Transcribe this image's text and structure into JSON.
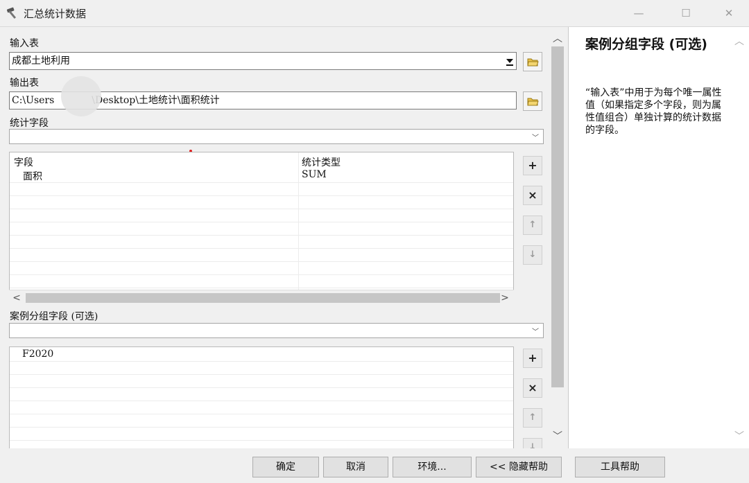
{
  "window": {
    "title": "汇总统计数据",
    "icon": "hammer-icon",
    "minimize_glyph": "—",
    "maximize_glyph": "☐",
    "close_glyph": "✕"
  },
  "form": {
    "input_table": {
      "label": "输入表",
      "value": "成都土地利用"
    },
    "output_table": {
      "label": "输出表",
      "value_before": "C:\\Users",
      "value_after": "\\Desktop\\土地统计\\面积统计"
    },
    "stats_field": {
      "label": "统计字段",
      "value": ""
    },
    "stats_grid": {
      "headers": [
        "字段",
        "统计类型"
      ],
      "rows": [
        {
          "field": "面积",
          "type": "SUM"
        }
      ]
    },
    "case_field": {
      "label": "案例分组字段 (可选)",
      "value": ""
    },
    "case_list": {
      "items": [
        "F2020"
      ]
    },
    "side_buttons": {
      "add": "+",
      "remove": "×",
      "up": "↑",
      "down": "↓"
    },
    "scroll": {
      "left": "<",
      "right": ">",
      "up": "︿",
      "down": "﹀"
    }
  },
  "help": {
    "title": "案例分组字段 (可选)",
    "body": "“输入表”中用于为每个唯一属性值（如果指定多个字段，则为属性值组合）单独计算的统计数据的字段。",
    "scroll_up": "︿",
    "scroll_down": "﹀"
  },
  "buttons": {
    "ok": "确定",
    "cancel": "取消",
    "environments": "环境...",
    "hide_help": "<< 隐藏帮助",
    "tool_help": "工具帮助"
  }
}
